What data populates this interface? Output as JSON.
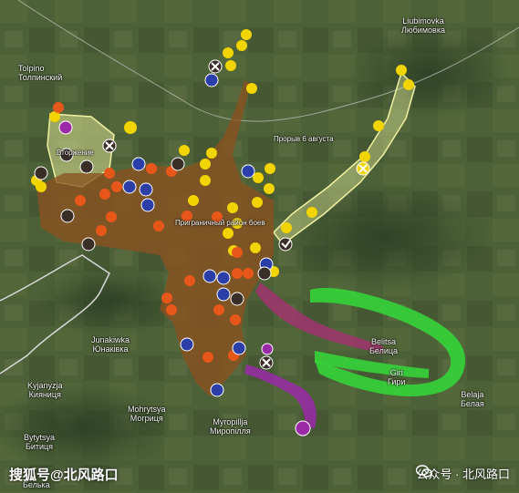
{
  "places": [
    {
      "id": "tolpino",
      "lat": "Tolpino",
      "cyr": "Толпинский"
    },
    {
      "id": "liubimovka",
      "lat": "Liubimovka",
      "cyr": "Любимовка"
    },
    {
      "id": "junakivka",
      "lat": "Junakiwka",
      "cyr": "Юнаківка"
    },
    {
      "id": "kyjanytsia",
      "lat": "Kyjanyzja",
      "cyr": "Кияниця"
    },
    {
      "id": "mohrytsia",
      "lat": "Mohrytsya",
      "cyr": "Могриця"
    },
    {
      "id": "myropillia",
      "lat": "Myropillja",
      "cyr": "Миропілля"
    },
    {
      "id": "bytytsia",
      "lat": "Bytytsya",
      "cyr": "Битиця"
    },
    {
      "id": "belitsa",
      "lat": "Belitsa",
      "cyr": "Белица"
    },
    {
      "id": "giri",
      "lat": "Giri",
      "cyr": "Гири"
    },
    {
      "id": "belaja",
      "lat": "Belaja",
      "cyr": "Белая"
    },
    {
      "id": "bilka",
      "lat": "",
      "cyr": "Белька"
    }
  ],
  "area_labels": {
    "main": "Приграничный район боев",
    "east": "Прорыв 6 августа",
    "west": "Вторжение"
  },
  "watermark": {
    "left": "搜狐号@北风路口",
    "right": "公众号 · 北风路口"
  },
  "colors": {
    "yellow_marker": "#f2d400",
    "orange_marker": "#e8571a",
    "blue_marker": "#2c3fa8",
    "dark_marker": "#3a2e28",
    "purple_marker": "#9b2aa8",
    "brown_zone": "#8a5220",
    "green_zone": "#35d43a",
    "magenta_zone": "#a0356e",
    "yellowgreen_zone": "#d8e090"
  }
}
